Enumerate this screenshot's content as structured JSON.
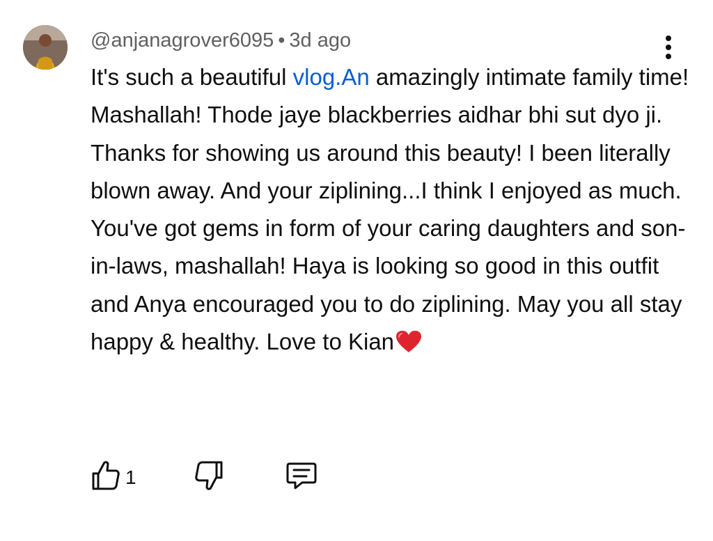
{
  "comment": {
    "author": "@anjanagrover6095",
    "separator": "•",
    "time": "3d ago",
    "text_before_link": "It's such a beautiful ",
    "link_text": "vlog.An",
    "text_after_link": " amazingly intimate family time! Mashallah! Thode jaye blackberries aidhar bhi sut dyo ji. Thanks for showing us around this beauty! I been literally blown away. And your ziplining...I think I enjoyed as much. You've got gems in form of your caring daughters and son-in-laws, mashallah! Haya is looking so good in this outfit and Anya encouraged you to do ziplining. May you all stay happy & healthy. Love to Kian",
    "like_count": "1"
  },
  "icons": {
    "menu": "more-vertical-icon",
    "like": "thumbs-up-icon",
    "dislike": "thumbs-down-icon",
    "reply": "reply-comment-icon",
    "emoji": "red-heart-emoji"
  },
  "colors": {
    "link": "#065fd4",
    "meta": "#606060",
    "text": "#0f0f0f",
    "heart": "#e0242f"
  }
}
